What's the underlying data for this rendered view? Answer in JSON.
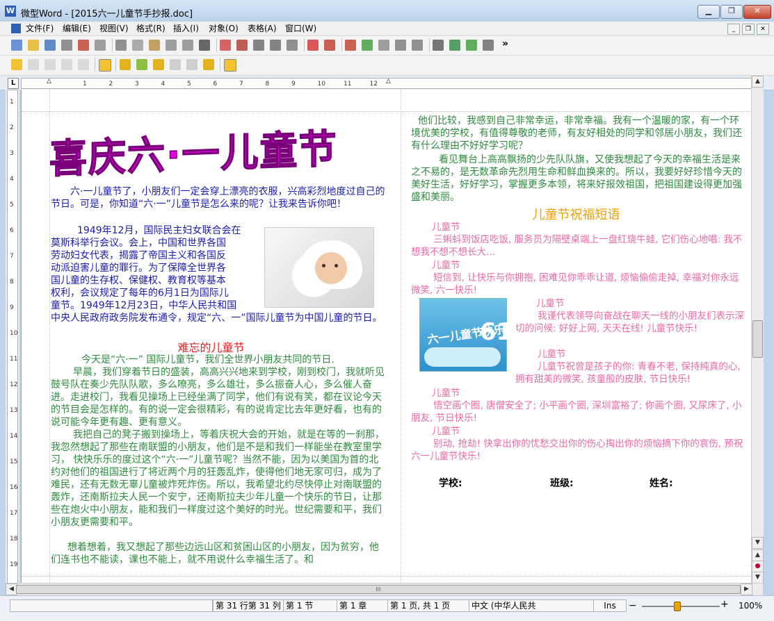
{
  "window": {
    "app_icon": "W",
    "title": "微型Word - [2015六一儿童节手抄报.doc]"
  },
  "menu": [
    "文件(F)",
    "编辑(E)",
    "视图(V)",
    "格式(R)",
    "插入(I)",
    "对象(O)",
    "表格(A)",
    "窗口(W)"
  ],
  "toolbar1_icons": [
    "new-doc-icon",
    "open-folder-icon",
    "save-icon",
    "print-icon",
    "pdf-icon",
    "print-preview-icon",
    "cut-icon",
    "copy-icon",
    "paste-icon",
    "undo-icon",
    "redo-icon",
    "find-icon",
    "zoom-100-icon",
    "page-view-icon",
    "outline-icon",
    "two-page-icon",
    "zoom-icon",
    "spellcheck-icon",
    "insert-text-icon",
    "field-icon",
    "spell-abc-icon",
    "chart-icon",
    "shape-icon",
    "frame-icon",
    "sync-icon",
    "paragraph-icon",
    "formula-icon",
    "toolbox-icon"
  ],
  "toolbar1_more": "»",
  "ruler": {
    "corner_label": "L",
    "h_ticks": [
      "1",
      "2",
      "3",
      "4",
      "5",
      "6",
      "7",
      "8",
      "9",
      "10",
      "11",
      "12"
    ],
    "v_ticks": [
      "1",
      "2",
      "3",
      "4",
      "5",
      "6",
      "7",
      "8",
      "9",
      "10",
      "11",
      "12",
      "13",
      "14",
      "15",
      "16",
      "17",
      "18",
      "19"
    ]
  },
  "document": {
    "title": "喜庆六·一儿童节",
    "intro": "六·一儿童节了，小朋友们一定会穿上漂亮的衣服，兴高彩烈地度过自己的节日。可是，你知道“六·一”儿童节是怎么来的呢？让我来告诉你吧！",
    "history_lines": [
      "1949年12月，国际民主妇女联合会在",
      "莫斯科举行会议。会上，中国和世界各国",
      "劳动妇女代表，揭露了帝国主义和各国反",
      "动派迫害儿童的罪行。为了保障全世界各",
      "国儿童的生存权、保健权、教育权等基本",
      "权利，会议规定了每年的6月1日为国际儿",
      "童节。1949年12月23日，中华人民共和国"
    ],
    "history_tail": "中央人民政府政务院发布通令，规定“六、一”国际儿童节为中国儿童的节日。",
    "memorable_heading": "难忘的儿童节",
    "memorable_p1": "今天是“六·一” 国际儿童节，我们全世界小朋友共同的节日.",
    "memorable_p2": "早晨，我们穿着节日的盛装，高高兴兴地来到学校，刚到校门，我就听见鼓号队在奏少先队队歌，多么嘹亮，多么雄壮，多么振奋人心，多么催人奋进。走进校门，我看见操场上已经坐满了同学，他们有说有笑，都在议论今天的节目会是怎样的。有的说一定会很精彩，有的说肯定比去年更好看，也有的说可能今年更有趣、更有意义。",
    "memorable_p3": "我把自己的凳子搬到操场上，等着庆祝大会的开始，就是在等的一刹那，我忽然想起了那些在南联盟的小朋友，他们是不是和我们一样能坐在教室里学习， 快快乐乐的度过这个“六·一”儿童节呢？当然不能，因为以美国为首的北约对他们的祖国进行了将近两个月的狂轰乱炸，使得他们地无家可归，成为了难民，还有无数无辜儿童被炸死炸伤。所以，我希望北约尽快停止对南联盟的轰炸，还南斯拉夫人民一个安宁，还南斯拉夫少年儿童一个快乐的节日，让那些在炮火中小朋友，能和我们一样度过这个美好的时光。世纪需要和平，我们小朋友更需要和平。",
    "memorable_p4": "想着想着，我又想起了那些边远山区和贫困山区的小朋友，因为贫穷，他们连书也不能读，课也不能上，就不用说什么幸福生活了。和",
    "right_p1": "他们比较，我感到自己非常幸运，非常幸福。我有一个温暖的家，有一个环境优美的学校，有值得尊敬的老师，有友好相处的同学和邻居小朋友，我们还有什么理由不好好学习呢？",
    "right_p2": "看见舞台上高高飘扬的少先队队旗，又使我想起了今天的幸福生活是来之不易的，是无数革命先烈用生命和鲜血换来的。所以，我要好好珍惜今天的美好生活，好好学习，掌握更多本领，将来好报效祖国，把祖国建设得更加强盛和美丽。",
    "wishes_heading": "儿童节祝福短语",
    "wish_label": "儿童节",
    "wish1": "三蝌蚪到饭店吃饭, 服务员为隔壁桌端上一盘红烧牛蛙, 它们伤心地唱: 我不想我不想不想长大…",
    "wish2": "短信到, 让快乐与你拥抱, 困难见你乖乖让道, 烦恼偷偷走掉, 幸福对你永远微笑, 六一快乐!",
    "wish3": "我谨代表领导向奋战在聊天一线的小朋友们表示深切的问候: 好好上网, 天天在线! 儿童节快乐!",
    "wish4": "儿童节祝曾是孩子的你: 青春不老, 保持纯真的心, 拥有甜美的微笑, 孩童般的皮肤, 节日快乐!",
    "wish5": "悟空画个圈, 唐僧安全了; 小平画个圈, 深圳富裕了; 你画个圈, 又尿床了, 小朋友, 节日快乐!",
    "wish6": "别动, 抢劫! 快拿出你的忧愁交出你的伤心掏出你的烦恼摘下你的哀伤, 预祝六一儿童节快乐!",
    "card_text": "六一儿童节快乐",
    "card_six": "61",
    "footer": {
      "school": "学校:",
      "class": "班级:",
      "name": "姓名:"
    }
  },
  "scroll": {
    "up": "▲",
    "down": "▼",
    "prev": "▲",
    "select": "●",
    "next": "▼",
    "h_grip": "III"
  },
  "status": {
    "position": "第 31 行第 31 列",
    "section": "第 1 节",
    "chapter": "第 1 章",
    "page": "第 1 页, 共 1 页",
    "language": "中文 (中华人民共",
    "ins": "Ins",
    "zoom_minus": "−",
    "zoom_plus": "+",
    "zoom": "100%",
    "zoom_fraction": 0.45
  },
  "colors": {
    "title_magenta": "#e000e0",
    "body_blue": "#1c1ca8",
    "body_green": "#2e8b3e",
    "wish_pink": "#e86aa6",
    "heading_red": "#e02020",
    "heading_orange": "#f0a000"
  }
}
